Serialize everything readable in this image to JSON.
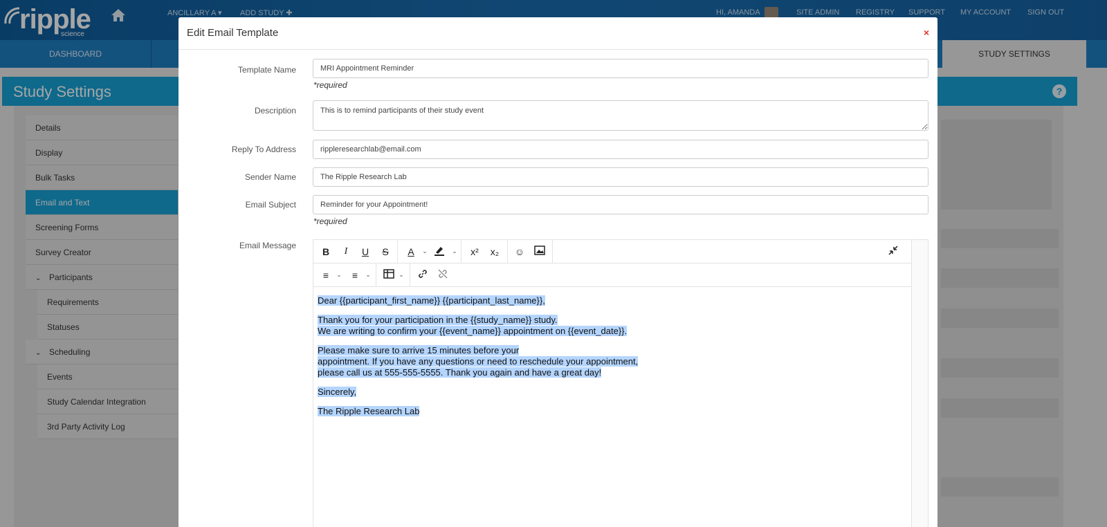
{
  "app": {
    "logo_word": "ripple",
    "logo_sub": "science"
  },
  "topnav": {
    "left_items": [
      "ANCILLARY A ▾",
      "ADD STUDY ✚"
    ],
    "greeting": "HI, AMANDA",
    "right_items": [
      "SITE ADMIN",
      "REGISTRY",
      "SUPPORT",
      "MY ACCOUNT",
      "SIGN OUT"
    ]
  },
  "tabs": {
    "dashboard": "DASHBOARD",
    "study_settings": "STUDY SETTINGS"
  },
  "page": {
    "title": "Study Settings",
    "help": "?"
  },
  "sidebar": {
    "items": [
      {
        "label": "Details"
      },
      {
        "label": "Display"
      },
      {
        "label": "Bulk Tasks"
      },
      {
        "label": "Email and Text"
      },
      {
        "label": "Screening Forms"
      },
      {
        "label": "Survey Creator"
      },
      {
        "label": "Participants"
      },
      {
        "label": "Requirements"
      },
      {
        "label": "Statuses"
      },
      {
        "label": "Scheduling"
      },
      {
        "label": "Events"
      },
      {
        "label": "Study Calendar Integration"
      },
      {
        "label": "3rd Party Activity Log"
      }
    ]
  },
  "modal": {
    "title": "Edit Email Template",
    "close": "×",
    "required_note": "*required",
    "fields": {
      "template_name": {
        "label": "Template Name",
        "value": "MRI Appointment Reminder"
      },
      "description": {
        "label": "Description",
        "value": "This is to remind participants of their study event"
      },
      "reply_to": {
        "label": "Reply To Address",
        "value": "rippleresearchlab@email.com"
      },
      "sender_name": {
        "label": "Sender Name",
        "value": "The Ripple Research Lab"
      },
      "email_subject": {
        "label": "Email Subject",
        "value": "Reminder for your Appointment!"
      },
      "email_message": {
        "label": "Email Message"
      }
    },
    "editor": {
      "line1": "Dear {{participant_first_name}} {{participant_last_name}},",
      "line2a": "Thank you for your participation in the {{study_name}} study.",
      "line2b": "We are writing to confirm your {{event_name}} appointment on {{event_date}}.",
      "line3a": "Please make sure to arrive 15 minutes before your",
      "line3b": "appointment. If you have any questions or need to reschedule your appointment,",
      "line3c": "please call us at 555-555-5555. Thank you again and have a great day!",
      "line4": "Sincerely,",
      "line5": "The Ripple Research Lab"
    }
  }
}
